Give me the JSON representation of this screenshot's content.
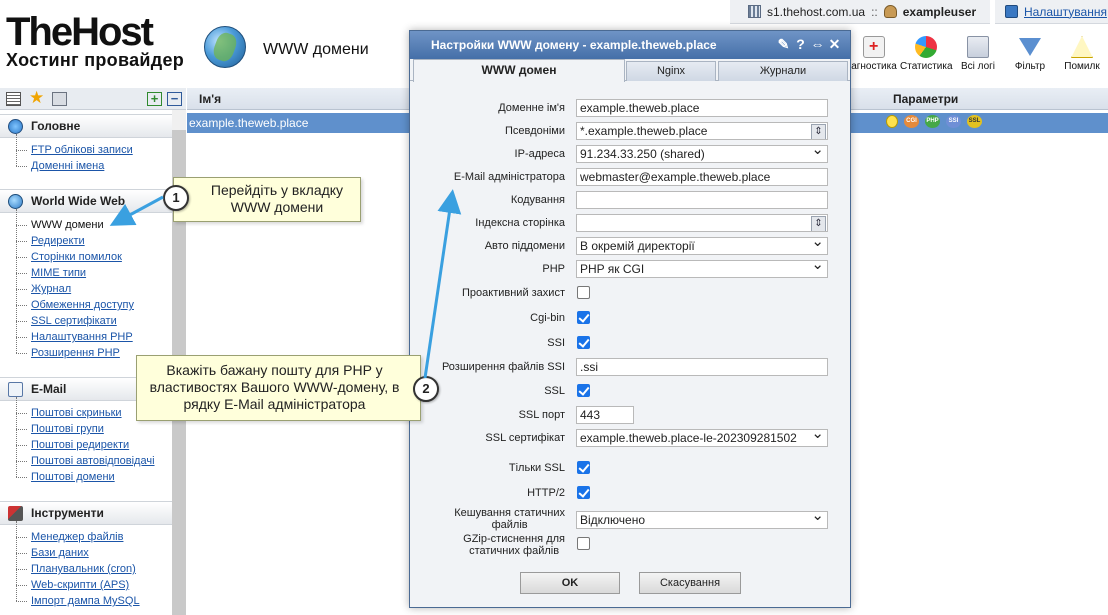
{
  "app": {
    "logo_main": "TheHost",
    "logo_sub": "Хостинг провайдер",
    "page_title": "WWW домени"
  },
  "topbar": {
    "server": "s1.thehost.com.ua",
    "separator": "::",
    "user": "exampleuser",
    "settings": "Налаштування"
  },
  "toolbar": {
    "items": [
      "агностика",
      "Статистика",
      "Всі логі",
      "Фільтр",
      "Помилк"
    ],
    "icons": [
      "diagnostics-icon",
      "statistics-icon",
      "logs-icon",
      "filter-icon",
      "help-icon"
    ]
  },
  "sidebar": {
    "sections": [
      {
        "title": "Головне",
        "items": [
          "FTP облікові записи",
          "Доменні імена"
        ]
      },
      {
        "title": "World Wide Web",
        "items": [
          "WWW домени",
          "Редиректи",
          "Сторінки помилок",
          "MIME типи",
          "Журнал",
          "Обмеження доступу",
          "SSL сертифікати",
          "Налаштування PHP",
          "Розширення PHP"
        ]
      },
      {
        "title": "E-Mail",
        "items": [
          "Поштові скриньки",
          "Поштові групи",
          "Поштові редиректи",
          "Поштові автовідповідачі",
          "Поштові домени"
        ]
      },
      {
        "title": "Інструменти",
        "items": [
          "Менеджер файлів",
          "Бази даних",
          "Планувальник (cron)",
          "Web-скрипти (APS)",
          "Імпорт дампа MySQL"
        ]
      }
    ]
  },
  "grid": {
    "col_name": "Ім'я",
    "col_params": "Параметри",
    "row_name": "example.theweb.place",
    "badges": [
      "CGI",
      "PHP",
      "SSI",
      "SSL"
    ]
  },
  "callouts": {
    "one": {
      "num": "1",
      "text": "Перейдіть у вкладку WWW домени"
    },
    "two": {
      "num": "2",
      "text": "Вкажіть бажану пошту для PHP у властивостях Вашого WWW-домену, в рядку E-Mail адміністратора"
    }
  },
  "dialog": {
    "title": "Настройки WWW домену - example.theweb.place",
    "tabs": [
      "WWW домен",
      "Nginx",
      "Журнали"
    ],
    "labels": {
      "domain": "Доменне ім'я",
      "aliases": "Псевдоніми",
      "ip": "IP-адреса",
      "email": "E-Mail адміністратора",
      "encoding": "Кодування",
      "index": "Індексна сторінка",
      "autosub": "Авто піддомени",
      "php": "PHP",
      "proactive": "Проактивний захист",
      "cgibin": "Cgi-bin",
      "ssi": "SSI",
      "ssi_ext": "Розширення файлів SSI",
      "ssl": "SSL",
      "ssl_port": "SSL порт",
      "ssl_cert": "SSL сертифікат",
      "ssl_only": "Тільки SSL",
      "http2": "HTTP/2",
      "cache_1": "Кешування статичних",
      "cache_2": "файлів",
      "gzip_1": "GZip-стиснення для",
      "gzip_2": "статичних файлів"
    },
    "values": {
      "domain": "example.theweb.place",
      "aliases": "*.example.theweb.place",
      "ip": "91.234.33.250 (shared)",
      "email": "webmaster@example.theweb.place",
      "encoding": "",
      "index": "",
      "autosub": "В окремій директорії",
      "php": "PHP як CGI",
      "ssi_ext": ".ssi",
      "ssl_port": "443",
      "ssl_cert": "example.theweb.place-le-202309281502",
      "cache": "Відключено"
    },
    "checks": {
      "proactive": false,
      "cgibin": true,
      "ssi": true,
      "ssl": true,
      "ssl_only": true,
      "http2": true,
      "gzip": false
    },
    "buttons": {
      "ok": "OK",
      "cancel": "Скасування"
    }
  }
}
